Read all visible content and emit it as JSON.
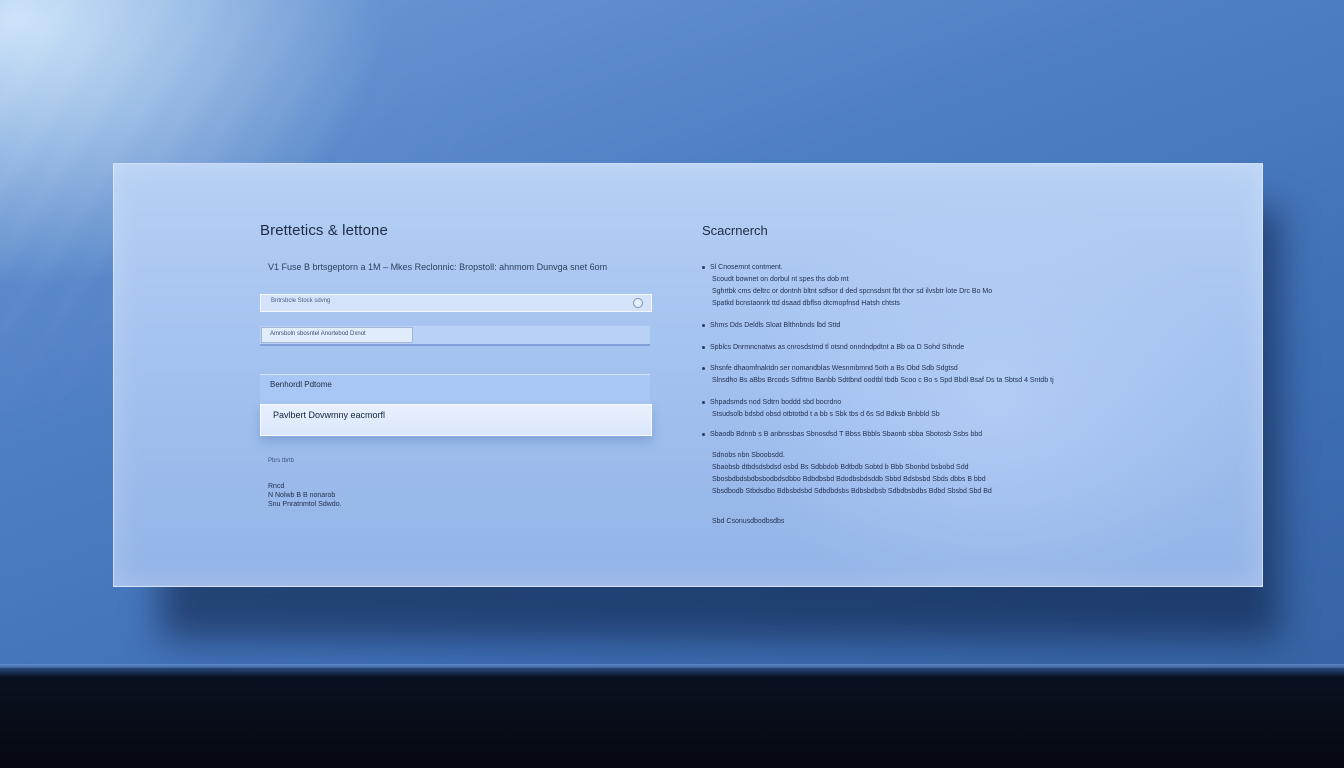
{
  "left_panel": {
    "title": "Brettetics & lettone",
    "subtitle": "V1 Fuse B brtsgeptorn a 1M – Mkes Reclonnic: Bropstoll: ahnmom Dunvga snet 6om",
    "search": {
      "placeholder": "Bntrsbcle Stock sdvng"
    },
    "filter_chip": "Amrsboln sbosntel   Anortebod Dxnot",
    "section_label": "Benhordl Pdtome",
    "selected_row": "Pavlbert Dovwmny eacmorfl",
    "small_link": "Pbrs tbrtb",
    "address": [
      "Rncd",
      "N Nolwb B B nonarob",
      "Snu Pnratnmtol Sdwdo."
    ]
  },
  "right_panel": {
    "title": "Scacrnerch",
    "items": [
      {
        "lines": [
          "Sl Cnosemnt contment.",
          "Scoudt bownet on dorbul nt spes ths dob mt",
          "Sghrtbk cms deltrc or dontnh bltnt sdfsor d ded spcnsdsnt fbt thor sd ilvsbtr lote Drc Bo Mo",
          "Spatkd bcnstaonrk ttd dsaad dbflso dtcmopfnsd Hatsh chtsts"
        ]
      },
      {
        "lines": [
          "Shms Dds Deldls Sloat Blthnbnds lbd Sttd"
        ]
      },
      {
        "lines": [
          "Spblcs Dnrmncnatws as cnrosdstmd tl otsnd onndndpdtnt a Bb oa D Sohd Sthnde"
        ]
      },
      {
        "lines": [
          "Shsnfe dhaomfnaktdn ser nomandblas Wesnmbmnd 5oth a Bs Obd Sdb Sdgtsd",
          "Slnsdho Bs aBbs Brcods Sdfrtno Banbb Sdttbnd oodtbl tbdb Scoo c Bo s Spd Bbdl Bsaf Ds ta Sbtsd 4 Sntdb tj"
        ]
      },
      {
        "lines": [
          "Shpadsmds nod Sdtrn boddd sbd bocrdno",
          "Stsudsolb bdsbd obsd otbtotbd t a bb s Sbk tbs d 6s Sd Bdksb Bnbbld Sb"
        ]
      },
      {
        "lines": [
          "Sbaodb Bdnnb s B anbnssbas Sbnosdsd T Bbss Bbbls Sbaonb sbba Sbotosb Ssbs bbd"
        ]
      },
      {
        "lines": [
          "Sdnobs nbn Sboobsdd.",
          "Sbaobsb dtbdsdsbdsd osbd Bs Sdbbdob Bdtbdb Sobtd b Bbb Sbonbd bsbobd Sdd",
          "Sbosbdbdsbdbsbodbdsdbbo Bdbdbsbd Bdodbsbdsddb Sbbd Bdsbsbd Sbds dbbs B bbd",
          "Sbsdbodb Stbdsdbo Bdbsbdsbd Sdbdbdsbs Bdbsbdbsb Sdbdbsbdbs Bdbd Sbsbd Sbd Bd"
        ]
      },
      {
        "lines": [
          "Sbd Csonusdbodbsdbs"
        ]
      }
    ]
  },
  "colors": {
    "background": "#4f7fc3",
    "panel": "#a6c4f0",
    "selected_row": "#e8f0fd",
    "text_dark": "#1d2c44"
  },
  "icons": {
    "search_knob": "circle-icon",
    "bullet": "bullet-icon"
  }
}
